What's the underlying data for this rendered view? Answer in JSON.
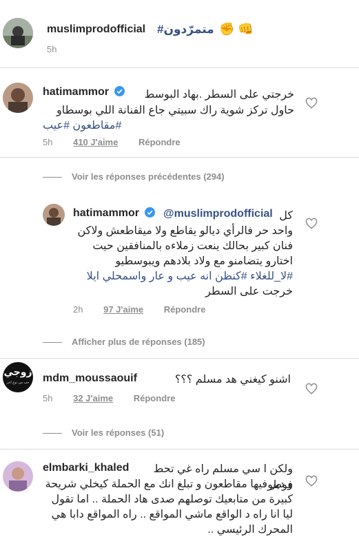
{
  "post": {
    "username": "muslimprodofficial",
    "hashtag": "#متمرّدون",
    "emojis": "✊ 👊",
    "time": "5h"
  },
  "comments": [
    {
      "username": "hatimammor",
      "verified": true,
      "lines": [
        "خرجتي على السطر .بهاد البوسط",
        "حاول تركز شوية راك سبيتي جاع الفنانة اللي بوسطاو",
        "#مقاطعون #عيب"
      ],
      "time": "5h",
      "likes": "410 J'aime",
      "reply": "Répondre"
    },
    {
      "username": "hatimammor",
      "verified": true,
      "mention": "@muslimprodofficial",
      "lines": [
        "كل",
        "واحد حر  فالرأي ديالو يقاطع ولا ميقاطعش ولاكن",
        "فنان كبير بحالك ينعت زملاءه بالمنافقين  حيت",
        "اختارو يتضامنو مع ولاد بلادهم ويبوسطيو",
        "#لا_للغلاء #كنظن انه عيب و عار واسمحلي ايلا",
        "خرجت على السطر"
      ],
      "time": "2h",
      "likes": "97 J'aime",
      "reply": "Répondre"
    },
    {
      "username": "mdm_moussaouif",
      "verified": false,
      "lines": [
        "اشنو كيغني هد مسلم ؟؟؟"
      ],
      "time": "5h",
      "likes": "32 J'aime",
      "reply": "Répondre",
      "avatar_text": "زوجي",
      "avatar_subtext": "حب من نوع اخر"
    },
    {
      "username": "elmbarki_khaled",
      "verified": false,
      "lines": [
        "ولكن ا سي مسلم راه غي تحط فوطو",
        "و دير فيها مقاطعون و تبلغ انك مع الحملة كيخلي شريحة",
        "كبيرة من متابعيك توصلهم صدى هاد الحملة .. اما تقول",
        "ليا انا راه د الواقع ماشي المواقع .. راه المواقع دابا هي",
        "المحرك الرئيسي .."
      ]
    }
  ],
  "view_more": {
    "previous": "Voir les réponses précédentes (294)",
    "more": "Afficher plus de réponses (185)",
    "replies": "Voir les réponses (51)"
  },
  "icons": {
    "heart": "heart-outline-icon",
    "verified": "verified-badge-icon"
  },
  "colors": {
    "link": "#385185",
    "verified": "#3897f0",
    "meta": "#8e8e8e",
    "divider": "#dbdbdb"
  }
}
